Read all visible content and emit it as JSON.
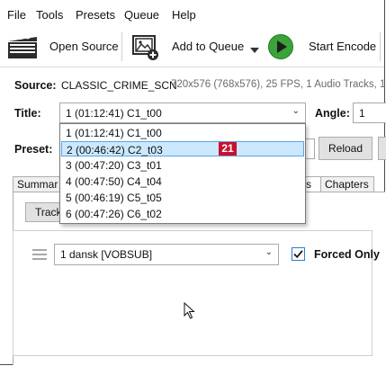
{
  "menu": [
    "File",
    "Tools",
    "Presets",
    "Queue",
    "Help"
  ],
  "toolbar": {
    "open_source": "Open Source",
    "add_to_queue": "Add to Queue",
    "start_encode": "Start Encode",
    "icons": [
      "clapperboard-icon",
      "add-image-icon",
      "dropdown-caret-icon",
      "play-icon"
    ],
    "play_color": "#3aa33a"
  },
  "source": {
    "label": "Source:",
    "name": "CLASSIC_CRIME_SCN",
    "info": "720x576 (768x576), 25 FPS, 1 Audio Tracks, 1"
  },
  "title": {
    "label": "Title:",
    "selected": "1  (01:12:41)  C1_t00",
    "options": [
      "1  (01:12:41)  C1_t00",
      "2  (00:46:42)  C2_t03",
      "3  (00:47:20)  C3_t01",
      "4  (00:47:50)  C4_t04",
      "5  (00:46:19)  C5_t05",
      "6  (00:47:26)  C6_t02"
    ],
    "highlighted_index": 1,
    "badge": "21",
    "badge_color": "#c8102e"
  },
  "angle": {
    "label": "Angle:",
    "value": "1"
  },
  "preset": {
    "label": "Preset:",
    "reload": "Reload"
  },
  "tabs": {
    "summary": "Summar",
    "subtitles_tail": "s",
    "chapters": "Chapters"
  },
  "tracks_button": "Track",
  "subtitle_row": {
    "track": "1 dansk [VOBSUB]",
    "forced_only": "Forced Only",
    "forced_checked": true,
    "accent": "#2b7bd6"
  }
}
